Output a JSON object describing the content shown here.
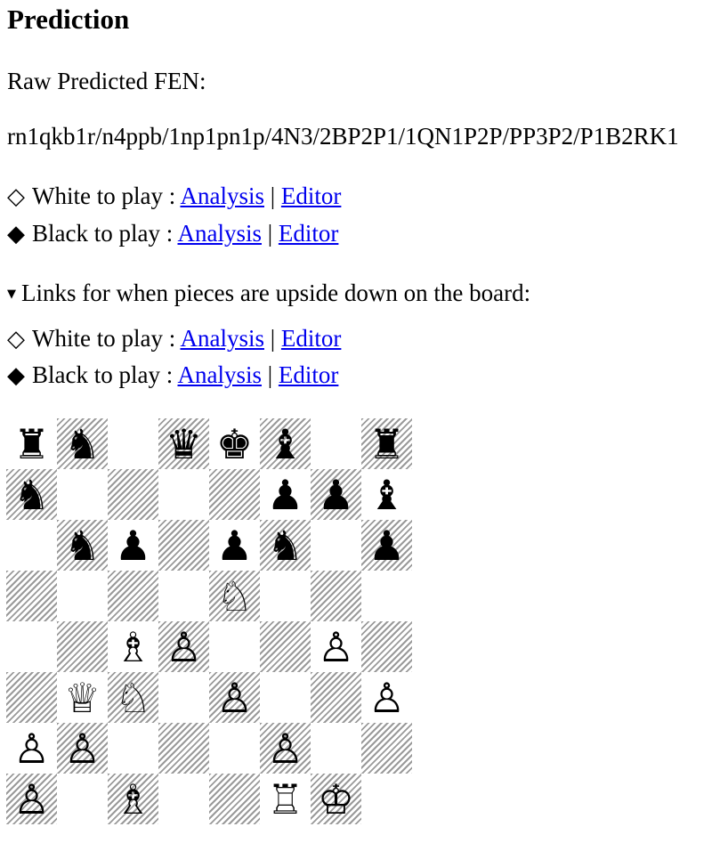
{
  "title": "Prediction",
  "raw_label": "Raw Predicted FEN:",
  "fen": "rn1qkb1r/n4ppb/1np1pn1p/4N3/2BP2P1/1QN1P2P/PP3P2/P1B2RK1",
  "links": {
    "white_symbol": "◇",
    "black_symbol": "◆",
    "white_text": "White to play : ",
    "black_text": "Black to play : ",
    "analysis": "Analysis",
    "editor": "Editor",
    "sep": " | "
  },
  "upside_down_label": "Links for when pieces are upside down on the board:",
  "triangle": "▼",
  "board": {
    "rows": [
      [
        "♜",
        "♞",
        "",
        "♛",
        "♚",
        "♝",
        "",
        "♜"
      ],
      [
        "♞",
        "",
        "",
        "",
        "",
        "♟",
        "♟",
        "♝"
      ],
      [
        "",
        "♞",
        "♟",
        "",
        "♟",
        "♞",
        "",
        "♟"
      ],
      [
        "",
        "",
        "",
        "",
        "♘",
        "",
        "",
        ""
      ],
      [
        "",
        "",
        "♗",
        "♙",
        "",
        "",
        "♙",
        ""
      ],
      [
        "",
        "♕",
        "♘",
        "",
        "♙",
        "",
        "",
        "♙"
      ],
      [
        "♙",
        "♙",
        "",
        "",
        "",
        "♙",
        "",
        ""
      ],
      [
        "♙",
        "",
        "♗",
        "",
        "",
        "♖",
        "♔",
        ""
      ]
    ]
  }
}
